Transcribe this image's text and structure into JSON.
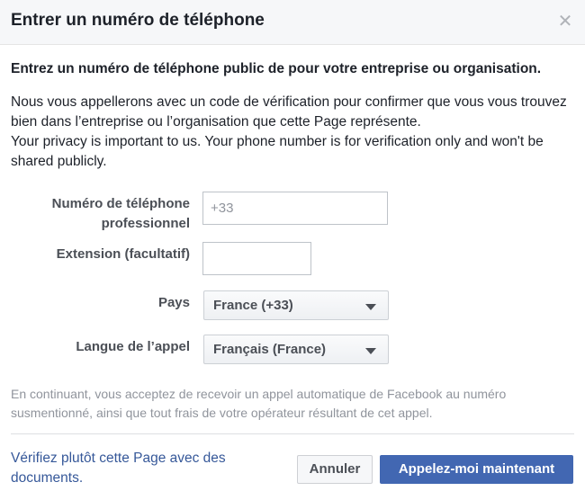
{
  "dialog": {
    "title": "Entrer un numéro de téléphone",
    "close_icon": "close-icon"
  },
  "content": {
    "lead": "Entrez un numéro de téléphone public de pour votre entreprise ou organisation.",
    "desc_line1": "Nous vous appellerons avec un code de vérification pour confirmer que vous vous trouvez bien dans l’entreprise ou l’organisation que cette Page représente.",
    "desc_line2": "Your privacy is important to us. Your phone number is for verification only and won't be shared publicly."
  },
  "form": {
    "phone_label": "Numéro de téléphone professionnel",
    "phone_placeholder": "+33",
    "phone_value": "",
    "extension_label": "Extension (facultatif)",
    "extension_value": "",
    "country_label": "Pays",
    "country_value": "France (+33)",
    "language_label": "Langue de l’appel",
    "language_value": "Français (France)"
  },
  "consent_text": "En continuant, vous acceptez de recevoir un appel automatique de Facebook au numéro susmentionné, ainsi que tout frais de votre opérateur résultant de cet appel.",
  "footer": {
    "docs_link": "Vérifiez plutôt cette Page avec des documents.",
    "cancel_label": "Annuler",
    "call_label": "Appelez-moi maintenant"
  },
  "colors": {
    "primary_button": "#4267b2",
    "link": "#365899",
    "header_bg": "#f6f7f9"
  }
}
